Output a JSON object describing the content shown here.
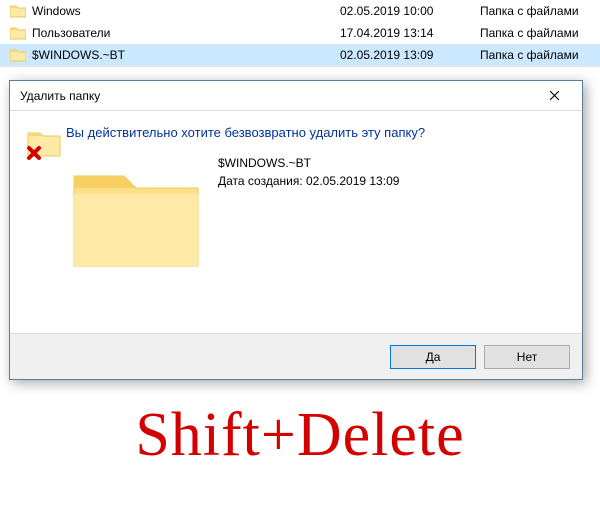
{
  "filelist": {
    "rows": [
      {
        "name": "Windows",
        "date": "02.05.2019 10:00",
        "type": "Папка с файлами",
        "selected": false
      },
      {
        "name": "Пользователи",
        "date": "17.04.2019 13:14",
        "type": "Папка с файлами",
        "selected": false
      },
      {
        "name": "$WINDOWS.~BT",
        "date": "02.05.2019 13:09",
        "type": "Папка с файлами",
        "selected": true
      }
    ]
  },
  "dialog": {
    "title": "Удалить папку",
    "question": "Вы действительно хотите безвозвратно удалить эту папку?",
    "item_name": "$WINDOWS.~BT",
    "created_label": "Дата создания: 02.05.2019 13:09",
    "yes": "Да",
    "no": "Нет"
  },
  "caption": "Shift+Delete"
}
